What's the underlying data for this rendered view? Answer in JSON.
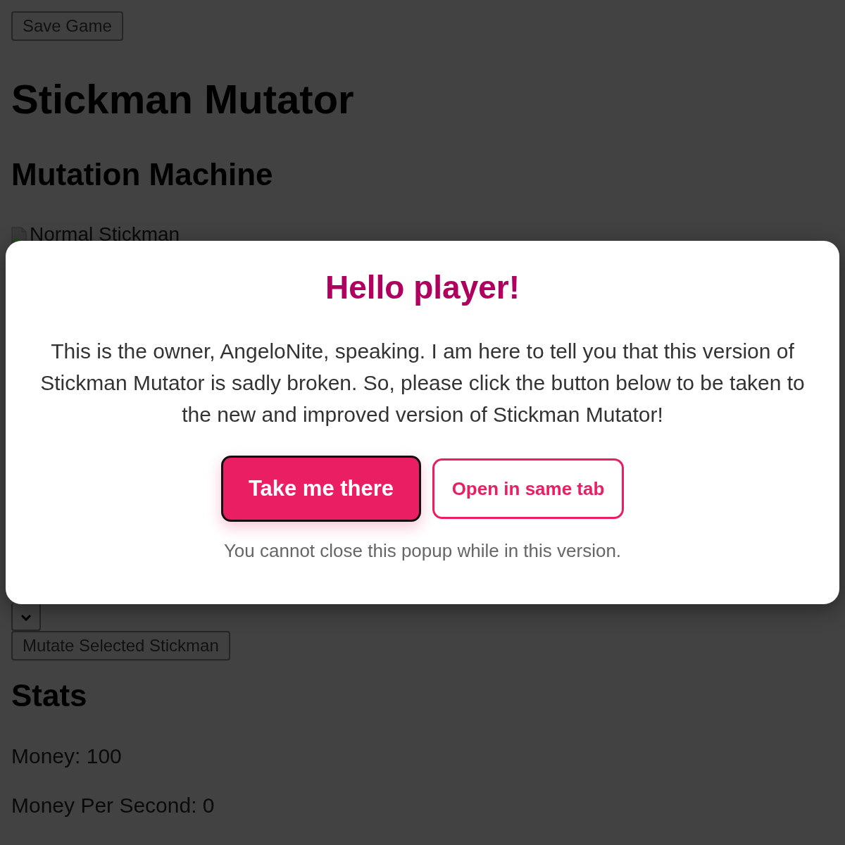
{
  "page": {
    "save_button": "Save Game",
    "title": "Stickman Mutator",
    "machine_heading": "Mutation Machine",
    "image_alt": "Normal Stickman",
    "mutate_button": "Mutate Selected Stickman",
    "stats_heading": "Stats",
    "stats": [
      "Money: 100",
      "Money Per Second: 0"
    ]
  },
  "popup": {
    "title": "Hello player!",
    "message": "This is the owner, AngeloNite, speaking. I am here to tell you that this version of Stickman Mutator is sadly broken. So, please click the button below to be taken to the new and improved version of Stickman Mutator!",
    "buttons": [
      {
        "label": "Take me there",
        "kind": "primary"
      },
      {
        "label": "Open in same tab",
        "kind": "outline"
      }
    ],
    "note": "You cannot close this popup while in this version."
  }
}
